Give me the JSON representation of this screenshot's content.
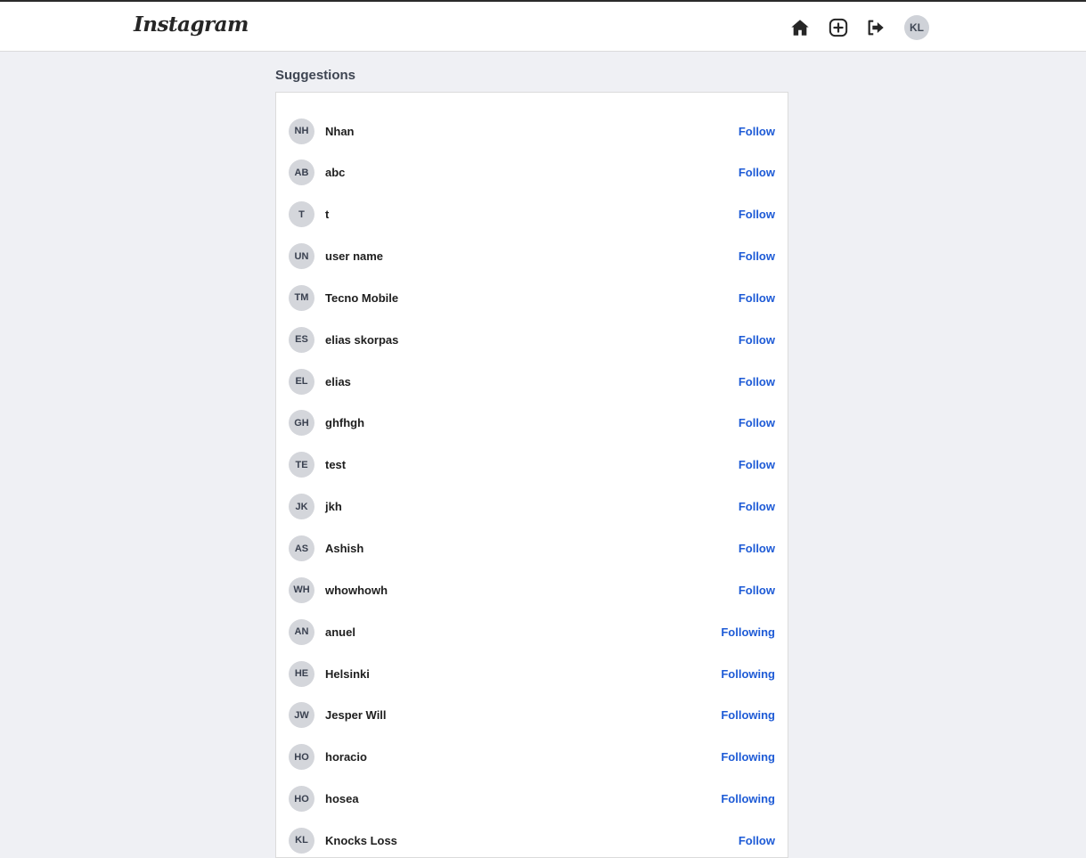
{
  "header": {
    "logo": "Instagram",
    "icons": [
      "home-icon",
      "new-post-icon",
      "logout-icon"
    ],
    "avatar_initials": "KL"
  },
  "suggestions": {
    "title": "Suggestions",
    "items": [
      {
        "initials": "NH",
        "name": "Nhan",
        "action": "Follow"
      },
      {
        "initials": "AB",
        "name": "abc",
        "action": "Follow"
      },
      {
        "initials": "T",
        "name": "t",
        "action": "Follow"
      },
      {
        "initials": "UN",
        "name": "user name",
        "action": "Follow"
      },
      {
        "initials": "TM",
        "name": "Tecno Mobile",
        "action": "Follow"
      },
      {
        "initials": "ES",
        "name": "elias skorpas",
        "action": "Follow"
      },
      {
        "initials": "EL",
        "name": "elias",
        "action": "Follow"
      },
      {
        "initials": "GH",
        "name": "ghfhgh",
        "action": "Follow"
      },
      {
        "initials": "TE",
        "name": "test",
        "action": "Follow"
      },
      {
        "initials": "JK",
        "name": "jkh",
        "action": "Follow"
      },
      {
        "initials": "AS",
        "name": "Ashish",
        "action": "Follow"
      },
      {
        "initials": "WH",
        "name": "whowhowh",
        "action": "Follow"
      },
      {
        "initials": "AN",
        "name": "anuel",
        "action": "Following"
      },
      {
        "initials": "HE",
        "name": "Helsinki",
        "action": "Following"
      },
      {
        "initials": "JW",
        "name": "Jesper Will",
        "action": "Following"
      },
      {
        "initials": "HO",
        "name": "horacio",
        "action": "Following"
      },
      {
        "initials": "HO",
        "name": "hosea",
        "action": "Following"
      },
      {
        "initials": "KL",
        "name": "Knocks Loss",
        "action": "Follow"
      }
    ]
  },
  "colors": {
    "accent": "#1e5bd6",
    "background": "#eff0f4"
  }
}
